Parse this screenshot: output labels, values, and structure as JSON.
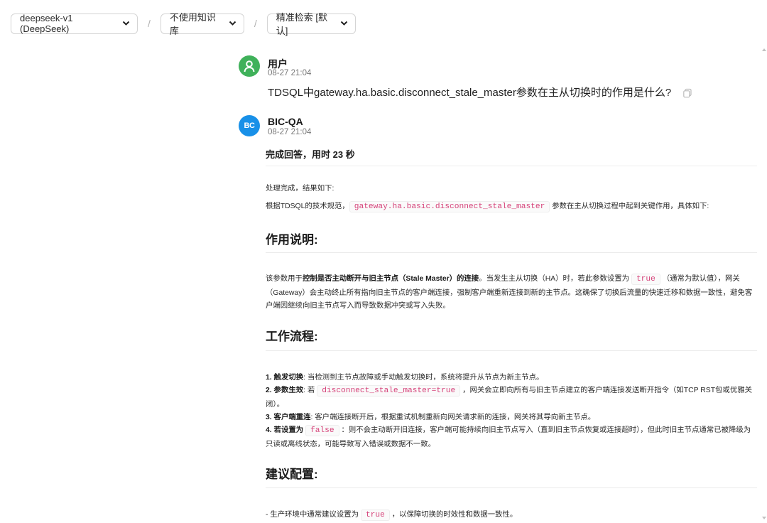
{
  "toolbar": {
    "model": "deepseek-v1 (DeepSeek)",
    "knowledge_base": "不使用知识库",
    "search_mode": "精准检索 [默认]",
    "separator": "/"
  },
  "user_message": {
    "author": "用户",
    "time": "08-27 21:04",
    "text": "TDSQL中gateway.ha.basic.disconnect_stale_master参数在主从切换时的作用是什么?"
  },
  "bot_message": {
    "author": "BIC-QA",
    "avatar_text": "BC",
    "time": "08-27 21:04",
    "status": "完成回答，用时 23 秒",
    "intro": "处理完成，结果如下:",
    "basis_prefix": "根据TDSQL的技术规范，",
    "basis_code": "gateway.ha.basic.disconnect_stale_master",
    "basis_suffix": "参数在主从切换过程中起到关键作用，具体如下:",
    "section1_title": "作用说明:",
    "s1_a": "该参数用于",
    "s1_b": "控制是否主动断开与旧主节点（Stale Master）的连接",
    "s1_c": "。当发生主从切换（HA）时，若此参数设置为",
    "s1_code": "true",
    "s1_d": "（通常为默认值），网关（Gateway）会主动终止所有指向旧主节点的客户端连接，强制客户端重新连接到新的主节点。这确保了切换后流量的快速迁移和数据一致性，避免客户端因继续向旧主节点写入而导致数据冲突或写入失败。",
    "section2_title": "工作流程:",
    "l1_b": "1. 触发切换",
    "l1_t": ": 当检测到主节点故障或手动触发切换时，系统将提升从节点为新主节点。",
    "l2_b": "2. 参数生效",
    "l2_t1": ": 若",
    "l2_code": "disconnect_stale_master=true",
    "l2_t2": "，网关会立即向所有与旧主节点建立的客户端连接发送断开指令（如TCP RST包或优雅关闭）。",
    "l3_b": "3. 客户端重连",
    "l3_t": ": 客户端连接断开后，根据重试机制重新向网关请求新的连接，网关将其导向新主节点。",
    "l4_b": "4. 若设置为",
    "l4_code": "false",
    "l4_t": "：则不会主动断开旧连接，客户端可能持续向旧主节点写入（直到旧主节点恢复或连接超时），但此时旧主节点通常已被降级为只读或离线状态，可能导致写入错误或数据不一致。",
    "section3_title": "建议配置:",
    "c1_a": "- 生产环境中通常建议设置为",
    "c1_code": "true",
    "c1_b": "，以保障切换的时效性和数据一致性。"
  }
}
